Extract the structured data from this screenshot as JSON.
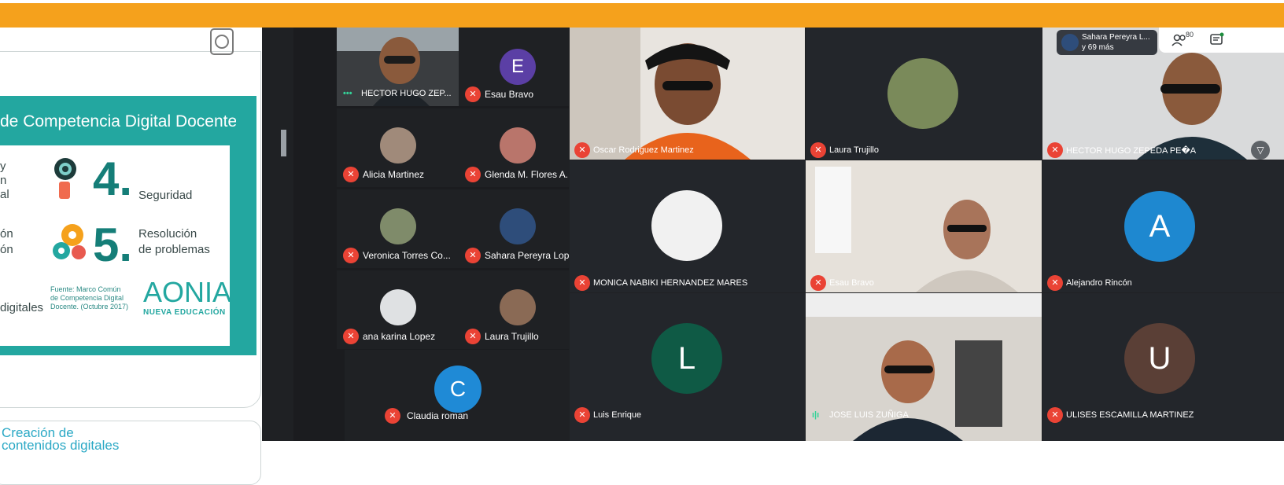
{
  "slides": {
    "heading": "de Competencia Digital Docente",
    "items": [
      {
        "number": "4.",
        "label": "Seguridad"
      },
      {
        "number": "5.",
        "label_line1": "Resolución",
        "label_line2": "de problemas"
      }
    ],
    "left_fragments": [
      "y",
      "n",
      "al",
      "ón",
      "ón",
      "digitales"
    ],
    "source_text": [
      "Fuente: Marco Común",
      "de Competencia Digital",
      "Docente. (Octubre 2017)"
    ],
    "brand": "AONIA",
    "brand_sub": "NUEVA EDUCACIÓN",
    "next_slide_title": [
      "Creación de",
      "contenidos digitales"
    ]
  },
  "meet": {
    "host_label": "Sahara Pereyra L...",
    "host_more": "y 69 más",
    "participant_count": "80",
    "small_grid": [
      {
        "name": "HECTOR HUGO ZEP...",
        "kind": "video",
        "status": "speaking"
      },
      {
        "name": "Esau Bravo",
        "kind": "letter",
        "letter": "E",
        "color": "#5b3fa5"
      },
      {
        "name": "Alicia Martinez",
        "kind": "photo"
      },
      {
        "name": "Glenda M. Flores A...",
        "kind": "photo"
      },
      {
        "name": "Veronica Torres Co...",
        "kind": "photo"
      },
      {
        "name": "Sahara Pereyra Lop...",
        "kind": "photo"
      },
      {
        "name": "ana karina Lopez",
        "kind": "photo"
      },
      {
        "name": "Laura Trujillo",
        "kind": "photo"
      },
      {
        "name": "Claudia roman",
        "kind": "letter",
        "letter": "C",
        "color": "#1f8ad6"
      }
    ],
    "tiles": [
      {
        "name": "Oscar Rodriguez Martinez",
        "kind": "video"
      },
      {
        "name": "Laura Trujillo",
        "kind": "photo"
      },
      {
        "name": "HECTOR HUGO ZEPEDA PE�A",
        "kind": "video"
      },
      {
        "name": "MONICA NABIKI HERNANDEZ MARES",
        "kind": "photo"
      },
      {
        "name": "Esau Bravo",
        "kind": "video"
      },
      {
        "name": "Alejandro Rincón",
        "kind": "letter",
        "letter": "A",
        "color": "#1e88d0"
      },
      {
        "name": "Luis Enrique",
        "kind": "letter",
        "letter": "L",
        "color": "#0f5a45"
      },
      {
        "name": "JOSE LUIS ZUÑIGA",
        "kind": "video",
        "status": "speaking"
      },
      {
        "name": "ULISES ESCAMILLA MARTINEZ",
        "kind": "letter",
        "letter": "U",
        "color": "#5a3f36"
      }
    ],
    "colors": {
      "accent_bar": "#f5a11c",
      "mic_off": "#ea4335",
      "background": "#1f2124"
    }
  }
}
